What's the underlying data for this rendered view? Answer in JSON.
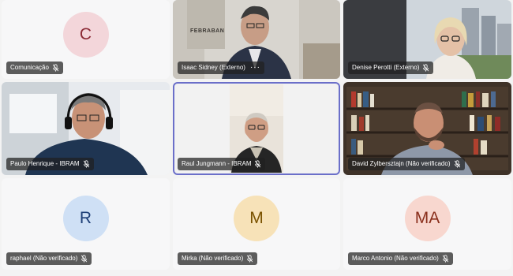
{
  "participants": [
    {
      "name": "Comunicação",
      "initials": "C",
      "avatar_bg": "#f3d6da",
      "avatar_fg": "#8b2a35"
    },
    {
      "name": "Isaac Sidney (Externo)",
      "video": true,
      "more": "···"
    },
    {
      "name": "Denise Perotti (Externo)",
      "video": true
    },
    {
      "name": "Paulo Henrique - IBRAM",
      "video": true
    },
    {
      "name": "Raul Jungmann - IBRAM",
      "video": true
    },
    {
      "name": "David Zylbersztajn (Não verificado)",
      "video": true
    },
    {
      "name": "raphael (Não verificado)",
      "initials": "R",
      "avatar_bg": "#cfe0f5",
      "avatar_fg": "#1e3f77"
    },
    {
      "name": "Mirka (Não verificado)",
      "initials": "M",
      "avatar_bg": "#f7e2b8",
      "avatar_fg": "#7a5200"
    },
    {
      "name": "Marco Antonio (Não verificado)",
      "initials": "MA",
      "avatar_bg": "#f8d7cf",
      "avatar_fg": "#8a2f1c"
    }
  ],
  "backdrop": {
    "wall_text": "FEBRABAN"
  },
  "icons": {
    "mic_muted": "mic-muted-icon",
    "more": "more-options-icon"
  }
}
